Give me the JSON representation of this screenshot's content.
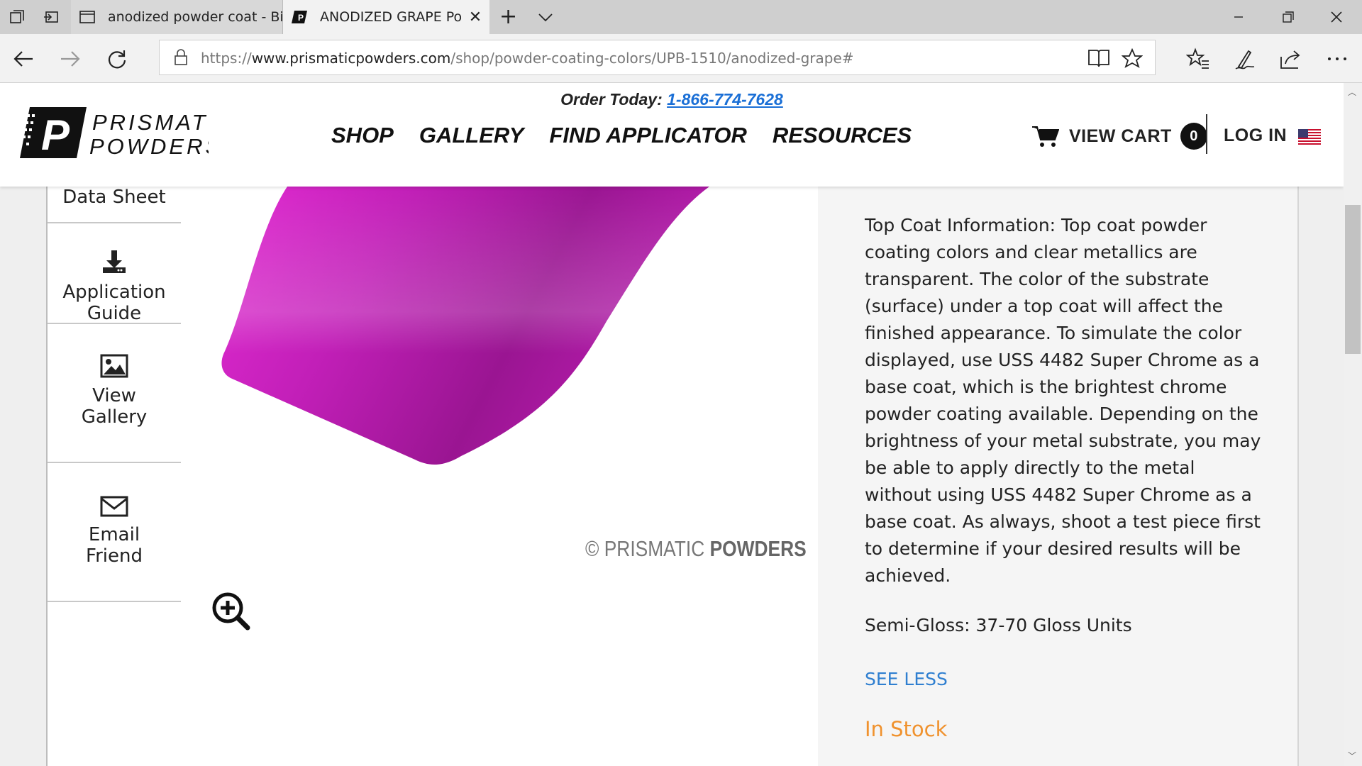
{
  "browser": {
    "tabs": [
      {
        "title": "anodized powder coat - Bin"
      },
      {
        "title": "ANODIZED GRAPE Pow"
      }
    ],
    "url": {
      "scheme": "https://",
      "host": "www.prismaticpowders.com",
      "path": "/shop/powder-coating-colors/UPB-1510/anodized-grape#"
    }
  },
  "header": {
    "order_label": "Order Today:",
    "phone": "1-866-774-7628",
    "logo_line1": "PRISMATIC",
    "logo_line2": "POWDERS",
    "nav": [
      "SHOP",
      "GALLERY",
      "FIND APPLICATOR",
      "RESOURCES"
    ],
    "cart_label": "VIEW CART",
    "cart_count": "0",
    "login_label": "LOG IN"
  },
  "sidebar": {
    "data_sheet": "Data Sheet",
    "app_guide_1": "Application",
    "app_guide_2": "Guide",
    "gallery_1": "View",
    "gallery_2": "Gallery",
    "email_1": "Email",
    "email_2": "Friend"
  },
  "product": {
    "watermark_prefix": "© PRISMATIC",
    "watermark_bold": "POWDERS",
    "swatch_color": "#c21fb8",
    "description": "Top Coat Information: Top coat powder coating colors and clear metallics are transparent. The color of the substrate (surface) under a top coat will affect the finished appearance. To simulate the color displayed, use USS 4482 Super Chrome as a base coat, which is the brightest chrome powder coating available. Depending on the brightness of your metal substrate, you may be able to apply directly to the metal without using USS 4482 Super Chrome as a base coat. As always, shoot a test piece first to determine if your desired results will be achieved.",
    "gloss": "Semi-Gloss: 37-70 Gloss Units",
    "see_less": "SEE LESS",
    "stock": "In Stock"
  }
}
